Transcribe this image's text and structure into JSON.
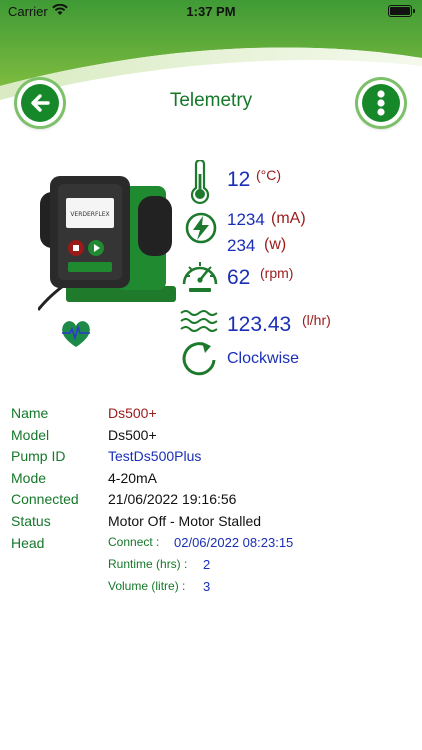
{
  "status_bar": {
    "carrier": "Carrier",
    "time": "1:37 PM"
  },
  "header": {
    "title": "Telemetry"
  },
  "colors": {
    "brand_green": "#16882a",
    "value_blue": "#1a2fb5",
    "unit_red": "#9b1a1a"
  },
  "telemetry": {
    "temperature": {
      "value": "12",
      "unit": "(°C)"
    },
    "current": {
      "value": "1234",
      "unit": "(mA)"
    },
    "power": {
      "value": "234",
      "unit": "(w)"
    },
    "speed": {
      "value": "62",
      "unit": "(rpm)"
    },
    "flow": {
      "value": "123.43",
      "unit": "(l/hr)"
    },
    "direction": {
      "value": "Clockwise"
    }
  },
  "info": {
    "name_label": "Name",
    "name_value": "Ds500+",
    "model_label": "Model",
    "model_value": "Ds500+",
    "pump_id_label": "Pump ID",
    "pump_id_value": "TestDs500Plus",
    "mode_label": "Mode",
    "mode_value": "4-20mA",
    "connected_label": "Connected",
    "connected_value": "21/06/2022 19:16:56",
    "status_label": "Status",
    "status_value": "Motor Off - Motor Stalled",
    "head_label": "Head",
    "head": {
      "connect_label": "Connect :",
      "connect_value": "02/06/2022 08:23:15",
      "runtime_label": "Runtime (hrs) :",
      "runtime_value": "2",
      "volume_label": "Volume (litre) :",
      "volume_value": "3"
    }
  },
  "pump_image": {
    "brand_text": "VERDERFLEX"
  }
}
